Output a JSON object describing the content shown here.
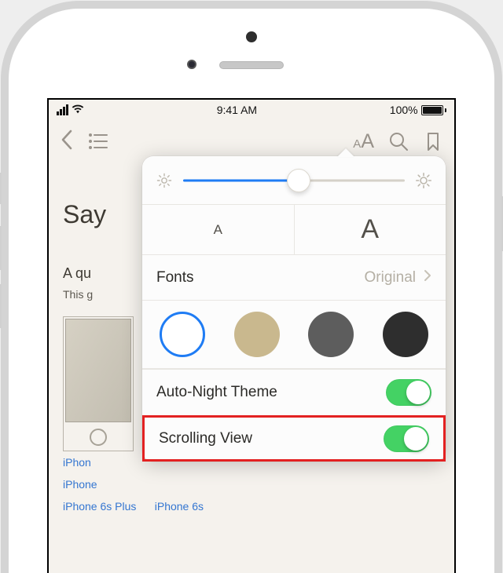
{
  "status": {
    "time": "9:41 AM",
    "battery": "100%"
  },
  "background": {
    "title": "Say",
    "sub": "A qu",
    "line": "This g",
    "links": {
      "l1": "iPhon",
      "l2": "iPhone",
      "l3": "iPhone 6s Plus",
      "l4": "iPhone 6s"
    }
  },
  "toolbar": {
    "fontsize_small": "A",
    "fontsize_large": "A"
  },
  "popover": {
    "fontsize_smaller": "A",
    "fontsize_larger": "A",
    "fonts_label": "Fonts",
    "fonts_value": "Original",
    "autonight_label": "Auto-Night Theme",
    "scrolling_label": "Scrolling View",
    "brightness_pct": 52,
    "autonight_on": true,
    "scrolling_on": true,
    "themes": [
      {
        "id": "white",
        "color": "#ffffff",
        "selected": true
      },
      {
        "id": "sepia",
        "color": "#c9b88e",
        "selected": false
      },
      {
        "id": "gray",
        "color": "#5d5d5d",
        "selected": false
      },
      {
        "id": "black",
        "color": "#2e2e2e",
        "selected": false
      }
    ]
  }
}
